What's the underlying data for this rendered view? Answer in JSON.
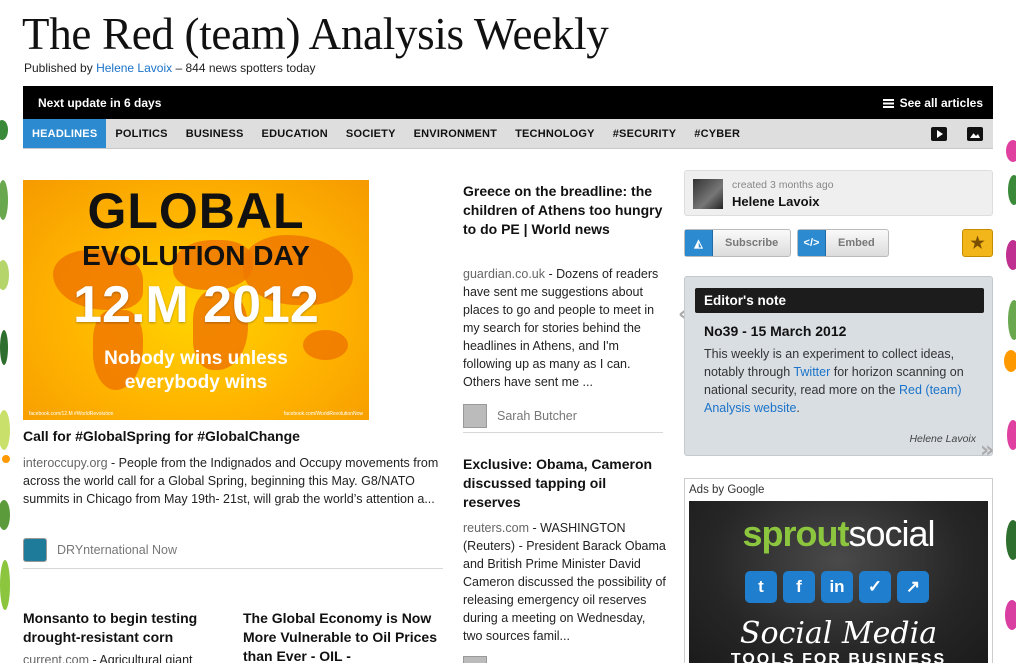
{
  "header": {
    "title": "The Red (team) Analysis Weekly",
    "byline_prefix": "Published by",
    "byline_author": "Helene Lavoix",
    "byline_suffix": "– 844 news spotters today"
  },
  "topbar": {
    "next_update": "Next update in 6 days",
    "see_all": "See all articles"
  },
  "nav": {
    "tabs": [
      "HEADLINES",
      "POLITICS",
      "BUSINESS",
      "EDUCATION",
      "SOCIETY",
      "ENVIRONMENT",
      "TECHNOLOGY",
      "#SECURITY",
      "#CYBER"
    ],
    "active": "HEADLINES",
    "icons": [
      "video-icon",
      "image-icon"
    ]
  },
  "feature_image": {
    "line1": "GLOBAL",
    "line2": "EVOLUTION DAY",
    "line3": "12.M 2012",
    "line4": "Nobody wins unless",
    "line5": "everybody wins",
    "foot_left": "facebook.com/12.M #WorldRevolution",
    "foot_right": "facebook.com/WorldRevolutionNow"
  },
  "articles": [
    {
      "title": "Call for #GlobalSpring for #GlobalChange",
      "source": "interoccupy.org",
      "body": " - People from the Indignados and Occupy movements from across the world call for a Global Spring, beginning this May. G8/NATO summits in Chicago from May 19th- 21st, will grab the world’s attention a...",
      "author": "DRYnternational Now"
    },
    {
      "title": "Greece on the breadline: the children of Athens too hungry to do PE | World news",
      "source": "guardian.co.uk",
      "body": " - Dozens of readers have sent me suggestions about places to go and people to meet in my search for stories behind the headlines in Athens, and I'm following up as many as I can. Others have sent me ...",
      "author": "Sarah Butcher"
    },
    {
      "title": "Exclusive: Obama, Cameron discussed tapping oil reserves",
      "source": "reuters.com",
      "body": " - WASHINGTON (Reuters) - President Barack Obama and British Prime Minister David Cameron discussed the possibility of releasing emergency oil reserves during a meeting on Wednesday, two sources famil..."
    },
    {
      "title": "Monsanto to begin testing drought-resistant corn",
      "source": "current.com",
      "body": " - Agricultural giant"
    },
    {
      "title": "The Global Economy is Now More Vulnerable to Oil Prices than Ever - OIL -"
    }
  ],
  "sidebar": {
    "created": "created 3 months ago",
    "creator_name": "Helene Lavoix",
    "subscribe": "Subscribe",
    "embed": "Embed",
    "editor_head": "Editor's note",
    "issue": "No39 - 15 March 2012",
    "note_1": "This weekly is an experiment to collect ideas, notably through ",
    "note_link1": "Twitter",
    "note_2": " for horizon scanning on national security, read more on the ",
    "note_link2": "Red (team) Analysis website",
    "note_3": ".",
    "signature": "Helene Lavoix",
    "ads_label": "Ads by Google",
    "ad_brand_1": "sprout",
    "ad_brand_2": "social",
    "ad_tag1": "Social Media",
    "ad_tag2": "TOOLS FOR BUSINESS"
  },
  "colors": {
    "accent": "#2b8ad0",
    "link": "#1a73c9",
    "topbar": "#000000",
    "star": "#f2b51a"
  }
}
